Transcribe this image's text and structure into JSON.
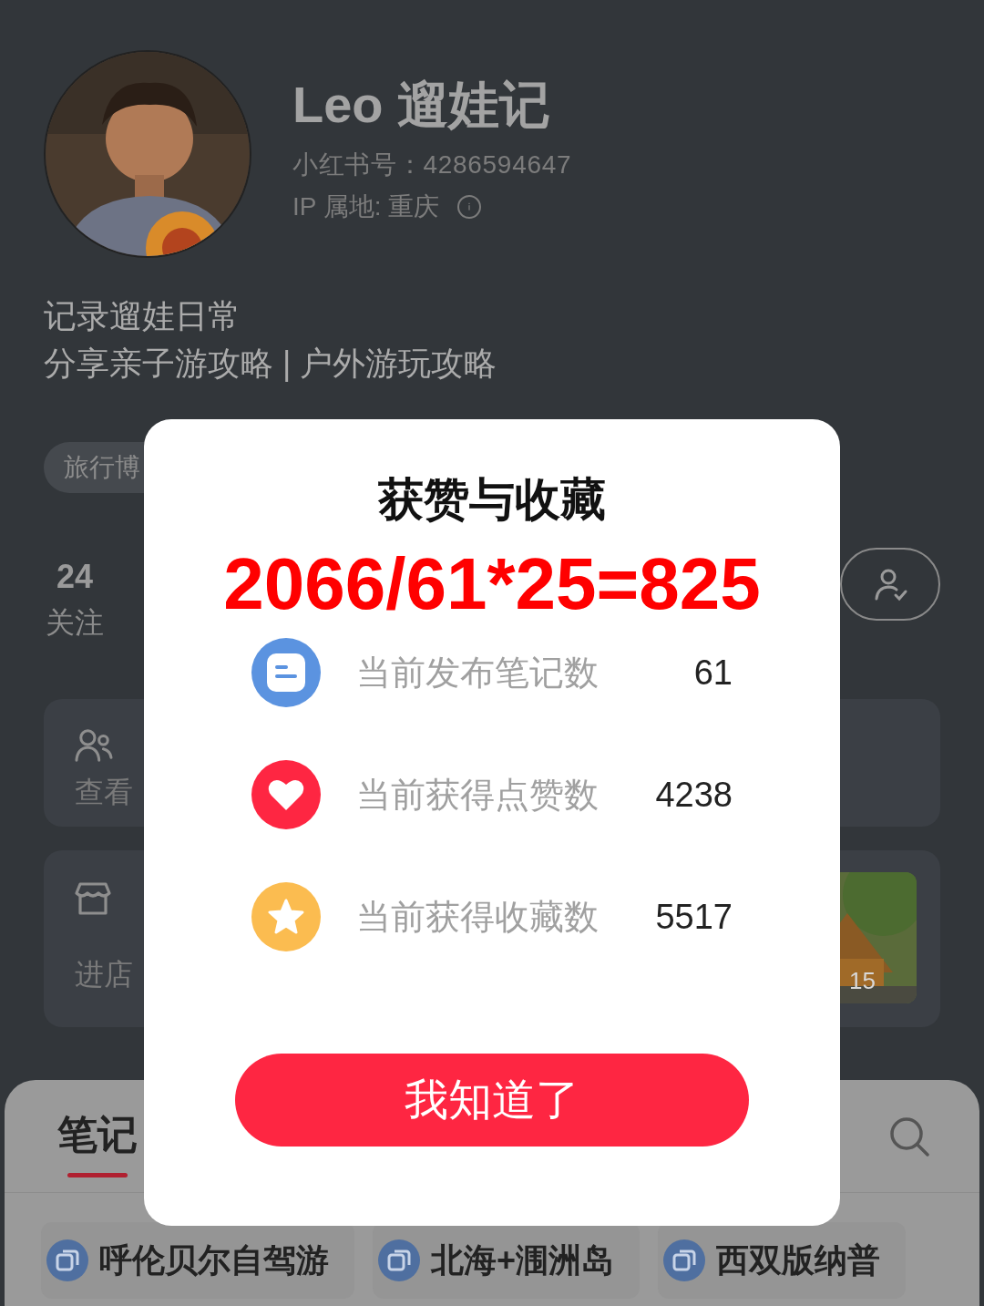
{
  "profile": {
    "name": "Leo 遛娃记",
    "id_line": "小红书号：4286594647",
    "ip_line": "IP 属地: 重庆",
    "bio": [
      "记录遛娃日常",
      "分享亲子游攻略 | 户外游玩攻略"
    ],
    "tag": "旅行博"
  },
  "stats": [
    {
      "value": "24",
      "label": "关注"
    }
  ],
  "cards": [
    {
      "kind": "group",
      "subtitle": "查看"
    },
    {
      "kind": "shop",
      "subtitle": "进店",
      "thumb_badge": "15"
    }
  ],
  "tabs": [
    {
      "label": "笔记",
      "selected": true
    }
  ],
  "collections": [
    {
      "label": "呼伦贝尔自驾游"
    },
    {
      "label": "北海+涠洲岛"
    },
    {
      "label": "西双版纳普"
    }
  ],
  "dialog": {
    "title": "获赞与收藏",
    "formula": "2066/61*25=825",
    "rows": [
      {
        "kind": "notes",
        "label": "当前发布笔记数",
        "value": "61"
      },
      {
        "kind": "likes",
        "label": "当前获得点赞数",
        "value": "4238"
      },
      {
        "kind": "favorites",
        "label": "当前获得收藏数",
        "value": "5517"
      }
    ],
    "button": "我知道了"
  }
}
